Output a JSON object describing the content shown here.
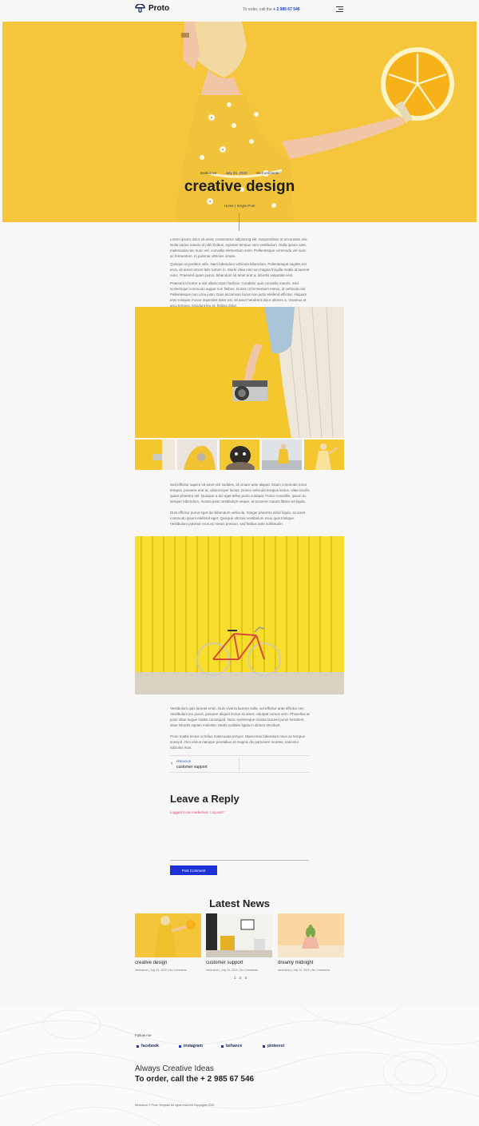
{
  "header": {
    "logo_text": "Proto",
    "order_prefix": "To order, call the",
    "order_phone": "+ 2 985 67 546"
  },
  "hero": {
    "author": "merkulove",
    "date": "July 24, 2020",
    "comments": "No Comments",
    "title": "creative design",
    "breadcrumb": "Home | Single Post"
  },
  "article": {
    "intro": [
      "Lorem ipsum dolor sit amet, consectetur adipiscing elit. Suspendisse at accumsan nisi. Nulla varius mauris id nibh finibus, egestas tempus sem vestibulum. Nulla ipsum ante, malesuada nec nunc vel, convallis elementum enim. Pellentesque commodo vel nunc ac fermentum. In pulvinar ultricies ornare.",
      "Quisque ut porttitor odio. Nam bibendum vehicula bibendum. Pellentesque sagittis est eros, sit amet rutrum felis rutrum in. Morbi vitae nisl non magna fringilla mattis id laoreet nunc. Praesent quam purus, bibendum sit amet erat a, lobortis vulputate erat.",
      "Praesent id tortor a nisl ullamcorper facilisis. Curabitur quis convallis mauris. Sed scelerisque commodo augue non finibus. Donec ut fermentum metus, id vehicula nisl. Pellentesque non urna justo. Duis accumsan lacus non justo eleifend efficitur. Aliquam erat volutpat. Fusce imperdiet dolor est, sit amet hendrerit dolor ultrices a. Vivamus at arcu tempus, tincidunt leo et, finibus dolor."
    ],
    "middle": [
      "Sed efficitur sapien sit amet nisl sodales, id ornare ante aliquet. Etiam commodo tortor tempus, posuere erat at, ullamcorper lectus. Donec vehicula tempus lectus, vitae iaculis quam pharetra vel. Quisque a dui eget tellus porta volutpat. Fusce convallis, ipsum ac semper bibendum, massa justo vestibulum neque, at posuere mauris libero vel ligula.",
      "Duis efficitur purus eget dui bibendum vehicula. Integer pharetra dolor ligula, sit amet commodo ipsum eleifend eget. Quisque ultrices vestibulum risus quis tristique. Vestibulum pulvinar eros ac metus pretium, sed finibus ante sollicitudin."
    ],
    "outro": [
      "Vestibulum quis laoreet enim. Duis viverra laoreet nulla, vel efficitur ante efficitur nec. Vestibulum leo purus, posuere aliquet lectus sit amet, volutpat cursus sem. Phasellus at justo vitae augue mattis consequat. Nunc scelerisque massa laoreet purus hendrerit, vitae lobortis sapien molestie. Morbi sodales ligula in dictum tincidunt.",
      "Proin mattis lectus ut tellus malesuada tempor. Maecenas bibendum risus ac tempus suscipit. Orci varius natoque penatibus et magnis dis parturient montes, nascetur ridiculus mus."
    ]
  },
  "post_nav": {
    "prev_label": "PREVIOUS",
    "prev_title": "customer support"
  },
  "reply": {
    "title": "Leave a Reply",
    "logged_in": "Logged in as merkulove. Log out?",
    "submit": "Post Comment"
  },
  "latest": {
    "title": "Latest News",
    "posts": [
      {
        "title": "creative design",
        "meta": "merkulove | July 24, 2020 | No Comments"
      },
      {
        "title": "customer support",
        "meta": "merkulove | July 24, 2020 | No Comments"
      },
      {
        "title": "dreamy midnight",
        "meta": "merkulove | July 24, 2020 | No Comments"
      }
    ],
    "pages": [
      "1",
      "2",
      "3"
    ]
  },
  "footer": {
    "follow": "Follow me",
    "social": [
      "facebook",
      "instagram",
      "behance",
      "pinterest"
    ],
    "tagline": "Always Creative Ideas",
    "order": "To order, call the + 2 985 67 546",
    "copyright": "Merkulove © Proto Template All rights reserved Copyrights 2020"
  },
  "colors": {
    "accent": "#1c31d6",
    "hero_bg": "#f5c53c",
    "link_pink": "#e0457b"
  }
}
